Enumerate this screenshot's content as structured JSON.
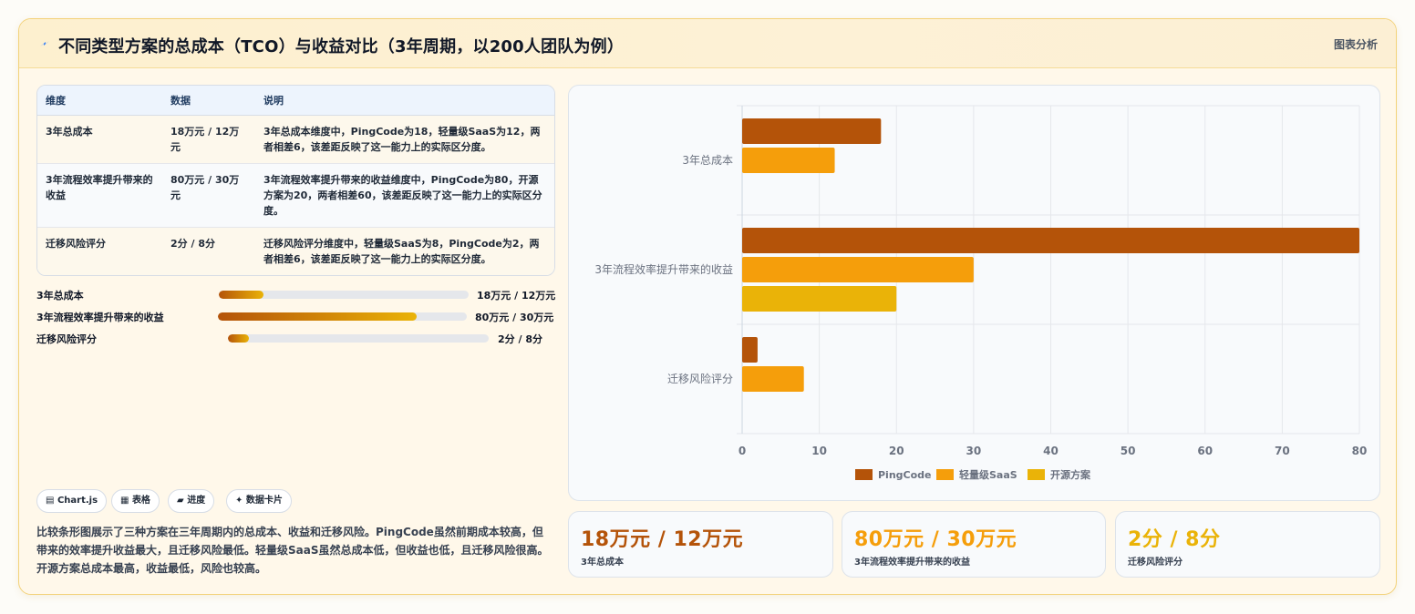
{
  "header": {
    "title": "不同类型方案的总成本（TCO）与收益对比（3年周期，以200人团队为例）",
    "tag": "图表分析"
  },
  "table": {
    "headers": [
      "维度",
      "数据",
      "说明"
    ],
    "rows": [
      {
        "dim": "3年总成本",
        "data": "18万元 / 12万元",
        "note": "3年总成本维度中，PingCode为18，轻量级SaaS为12，两者相差6，该差距反映了这一能力上的实际区分度。"
      },
      {
        "dim": "3年流程效率提升带来的收益",
        "data": "80万元 / 30万元",
        "note": "3年流程效率提升带来的收益维度中，PingCode为80，开源方案为20，两者相差60，该差距反映了这一能力上的实际区分度。"
      },
      {
        "dim": "迁移风险评分",
        "data": "2分 / 8分",
        "note": "迁移风险评分维度中，轻量级SaaS为8，PingCode为2，两者相差6，该差距反映了这一能力上的实际区分度。"
      }
    ]
  },
  "progress": [
    {
      "label": "3年总成本",
      "value": "18万元 / 12万元",
      "fill": 0.18
    },
    {
      "label": "3年流程效率提升带来的收益",
      "value": "80万元 / 30万元",
      "fill": 0.8
    },
    {
      "label": "迁移风险评分",
      "value": "2分 / 8分",
      "fill": 0.08
    }
  ],
  "pills": [
    "Chart.js",
    "表格",
    "进度",
    "数据卡片"
  ],
  "pill_icons": [
    "chart-icon",
    "table-icon",
    "folder-icon",
    "sparkle-icon"
  ],
  "description": "比较条形图展示了三种方案在三年周期内的总成本、收益和迁移风险。PingCode虽然前期成本较高，但带来的效率提升收益最大，且迁移风险最低。轻量级SaaS虽然总成本低，但收益也低，且迁移风险很高。开源方案总成本最高，收益最低，风险也较高。",
  "stats": [
    {
      "value": "18万元 / 12万元",
      "label": "3年总成本",
      "color": "#b45309"
    },
    {
      "value": "80万元 / 30万元",
      "label": "3年流程效率提升带来的收益",
      "color": "#f59e0b"
    },
    {
      "value": "2分 / 8分",
      "label": "迁移风险评分",
      "color": "#eab308"
    }
  ],
  "chart_data": {
    "type": "bar",
    "orientation": "horizontal",
    "categories": [
      "3年总成本",
      "3年流程效率提升带来的收益",
      "迁移风险评分"
    ],
    "series": [
      {
        "name": "PingCode",
        "values": [
          18,
          80,
          2
        ],
        "color": "#b45309"
      },
      {
        "name": "轻量级SaaS",
        "values": [
          12,
          30,
          8
        ],
        "color": "#f59e0b"
      },
      {
        "name": "开源方案",
        "values": [
          null,
          20,
          null
        ],
        "color": "#eab308"
      }
    ],
    "xlim": [
      0,
      80
    ],
    "xticks": [
      0,
      10,
      20,
      30,
      40,
      50,
      60,
      70,
      80
    ],
    "grid": true,
    "legend": "bottom"
  }
}
